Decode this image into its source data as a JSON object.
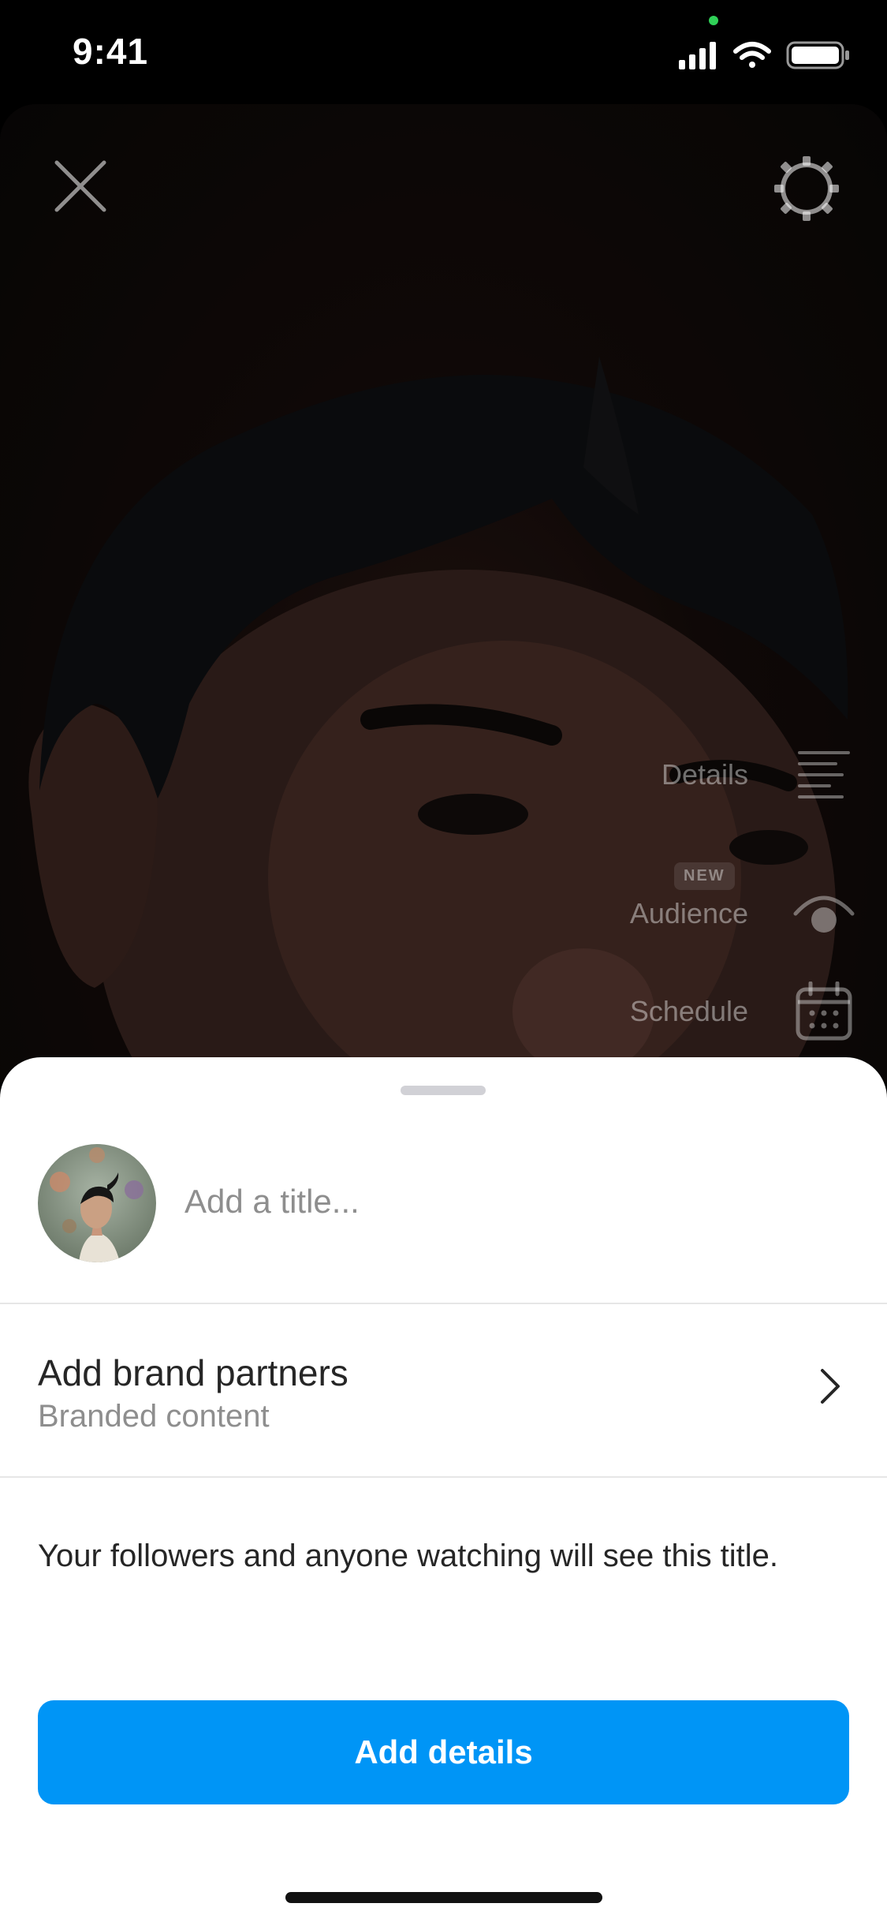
{
  "status_bar": {
    "time": "9:41",
    "icons": [
      "cellular-signal-icon",
      "wifi-icon",
      "battery-icon"
    ],
    "camera_indicator_color": "#30d158"
  },
  "preview": {
    "close_icon": "close-icon",
    "settings_icon": "gear-icon",
    "side_menu": [
      {
        "label": "Details",
        "icon": "details-lines-icon"
      },
      {
        "label": "Audience",
        "icon": "audience-eye-icon",
        "badge": "NEW"
      },
      {
        "label": "Schedule",
        "icon": "calendar-icon"
      }
    ]
  },
  "sheet": {
    "title_placeholder": "Add a title...",
    "title_value": "",
    "brand_partners": {
      "title": "Add brand partners",
      "subtitle": "Branded content"
    },
    "info_text": "Your followers and anyone watching will see this title.",
    "cta_label": "Add details"
  },
  "colors": {
    "accent": "#0095f6",
    "sheet_background": "#ffffff",
    "secondary_text": "#8e8e8e"
  }
}
